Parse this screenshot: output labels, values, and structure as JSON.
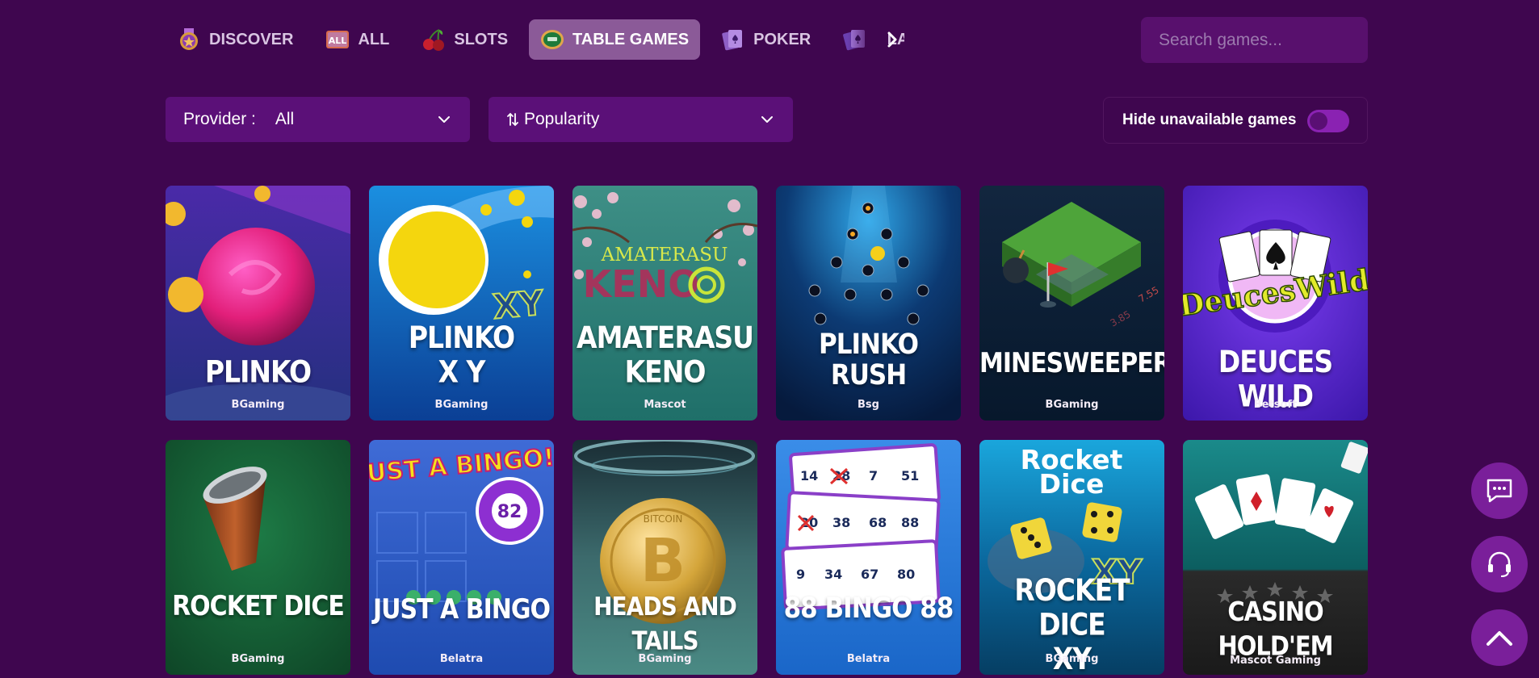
{
  "nav": {
    "tabs": [
      {
        "label": "DISCOVER",
        "icon": "discover-medal-icon",
        "active": false
      },
      {
        "label": "ALL",
        "icon": "all-games-icon",
        "active": false
      },
      {
        "label": "SLOTS",
        "icon": "cherry-icon",
        "active": false
      },
      {
        "label": "TABLE GAMES",
        "icon": "table-chip-icon",
        "active": true
      },
      {
        "label": "POKER",
        "icon": "poker-card-icon",
        "active": false
      },
      {
        "label": "BLAC",
        "icon": "blackjack-card-icon",
        "active": false
      }
    ],
    "next_icon": "chevron-right-icon"
  },
  "search": {
    "placeholder": "Search games...",
    "icon": "search-icon"
  },
  "filters": {
    "provider_label": "Provider :",
    "provider_value": "All",
    "sort_value": "Popularity",
    "sort_icon": "sort-arrows-icon",
    "hide_unavailable_label": "Hide unavailable games",
    "hide_unavailable_on": false
  },
  "games": [
    {
      "title": "PLINKO",
      "provider": "BGaming"
    },
    {
      "title": "PLINKO\nX Y",
      "provider": "BGaming",
      "badge": "XY"
    },
    {
      "title": "AMATERASU\nKENO",
      "provider": "Mascot",
      "art_top": "AMATERASU",
      "art_big": "KENO"
    },
    {
      "title": "PLINKO\nRUSH",
      "provider": "Bsg"
    },
    {
      "title": "MINESWEEPERE",
      "provider": "BGaming",
      "art_numbers": [
        "7.55",
        "3.85"
      ]
    },
    {
      "title": "DEUCES WILD",
      "provider": "Betsoft",
      "art_logo": "DeucesWild"
    },
    {
      "title": "ROCKET DICE",
      "provider": "BGaming"
    },
    {
      "title": "JUST A BINGO",
      "provider": "Belatra",
      "art_logo": "JUST A BINGO!",
      "art_ball": "82"
    },
    {
      "title": "HEADS AND TAILS",
      "provider": "BGaming",
      "art_coin": "BITCOIN"
    },
    {
      "title": "88 BINGO 88",
      "provider": "Belatra"
    },
    {
      "title": "ROCKET DICE\nXY",
      "provider": "BGaming",
      "art_logo": "Rocket\nDice",
      "badge": "XY"
    },
    {
      "title": "CASINO HOLD'EM",
      "provider": "Mascot Gaming"
    }
  ],
  "fabs": [
    "chat-icon",
    "support-headset-icon",
    "scroll-top-icon"
  ],
  "colors": {
    "background": "#3f064f",
    "active_tab": "#8b5a98",
    "panel": "#5b1078",
    "toggle": "#8a22b2"
  }
}
